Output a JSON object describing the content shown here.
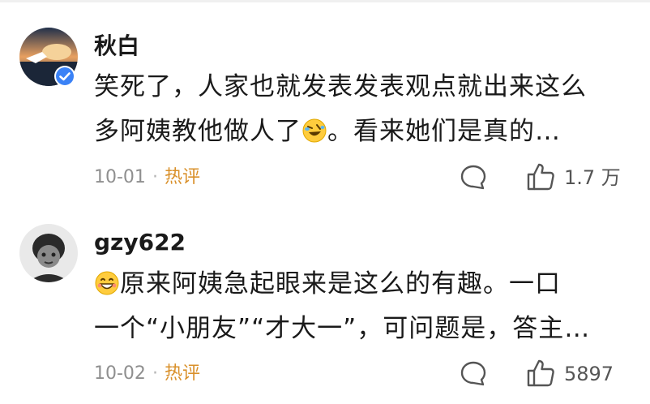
{
  "comments": [
    {
      "username": "秋白",
      "verified": true,
      "text_lines": [
        "笑死了，人家也就发表发表观点就出来这么",
        "多阿姨教他做人了",
        "。看来她们是真的…"
      ],
      "emoji_name": "rolling-laughing-emoji",
      "date": "10-01",
      "separator": "·",
      "tag": "热评",
      "likes": "1.7 万"
    },
    {
      "username": "gzy622",
      "verified": false,
      "emoji_name": "grinning-emoji",
      "text_lines": [
        "原来阿姨急起眼来是这么的有趣。一口",
        "一个“小朋友”“才大一”，可问题是，答主…"
      ],
      "date": "10-02",
      "separator": "·",
      "tag": "热评",
      "likes": "5897"
    }
  ],
  "colors": {
    "username": "#1a1a1a",
    "meta": "#8f8f8f",
    "hot_tag": "#d9902a",
    "verified_badge": "#3b82f6"
  }
}
